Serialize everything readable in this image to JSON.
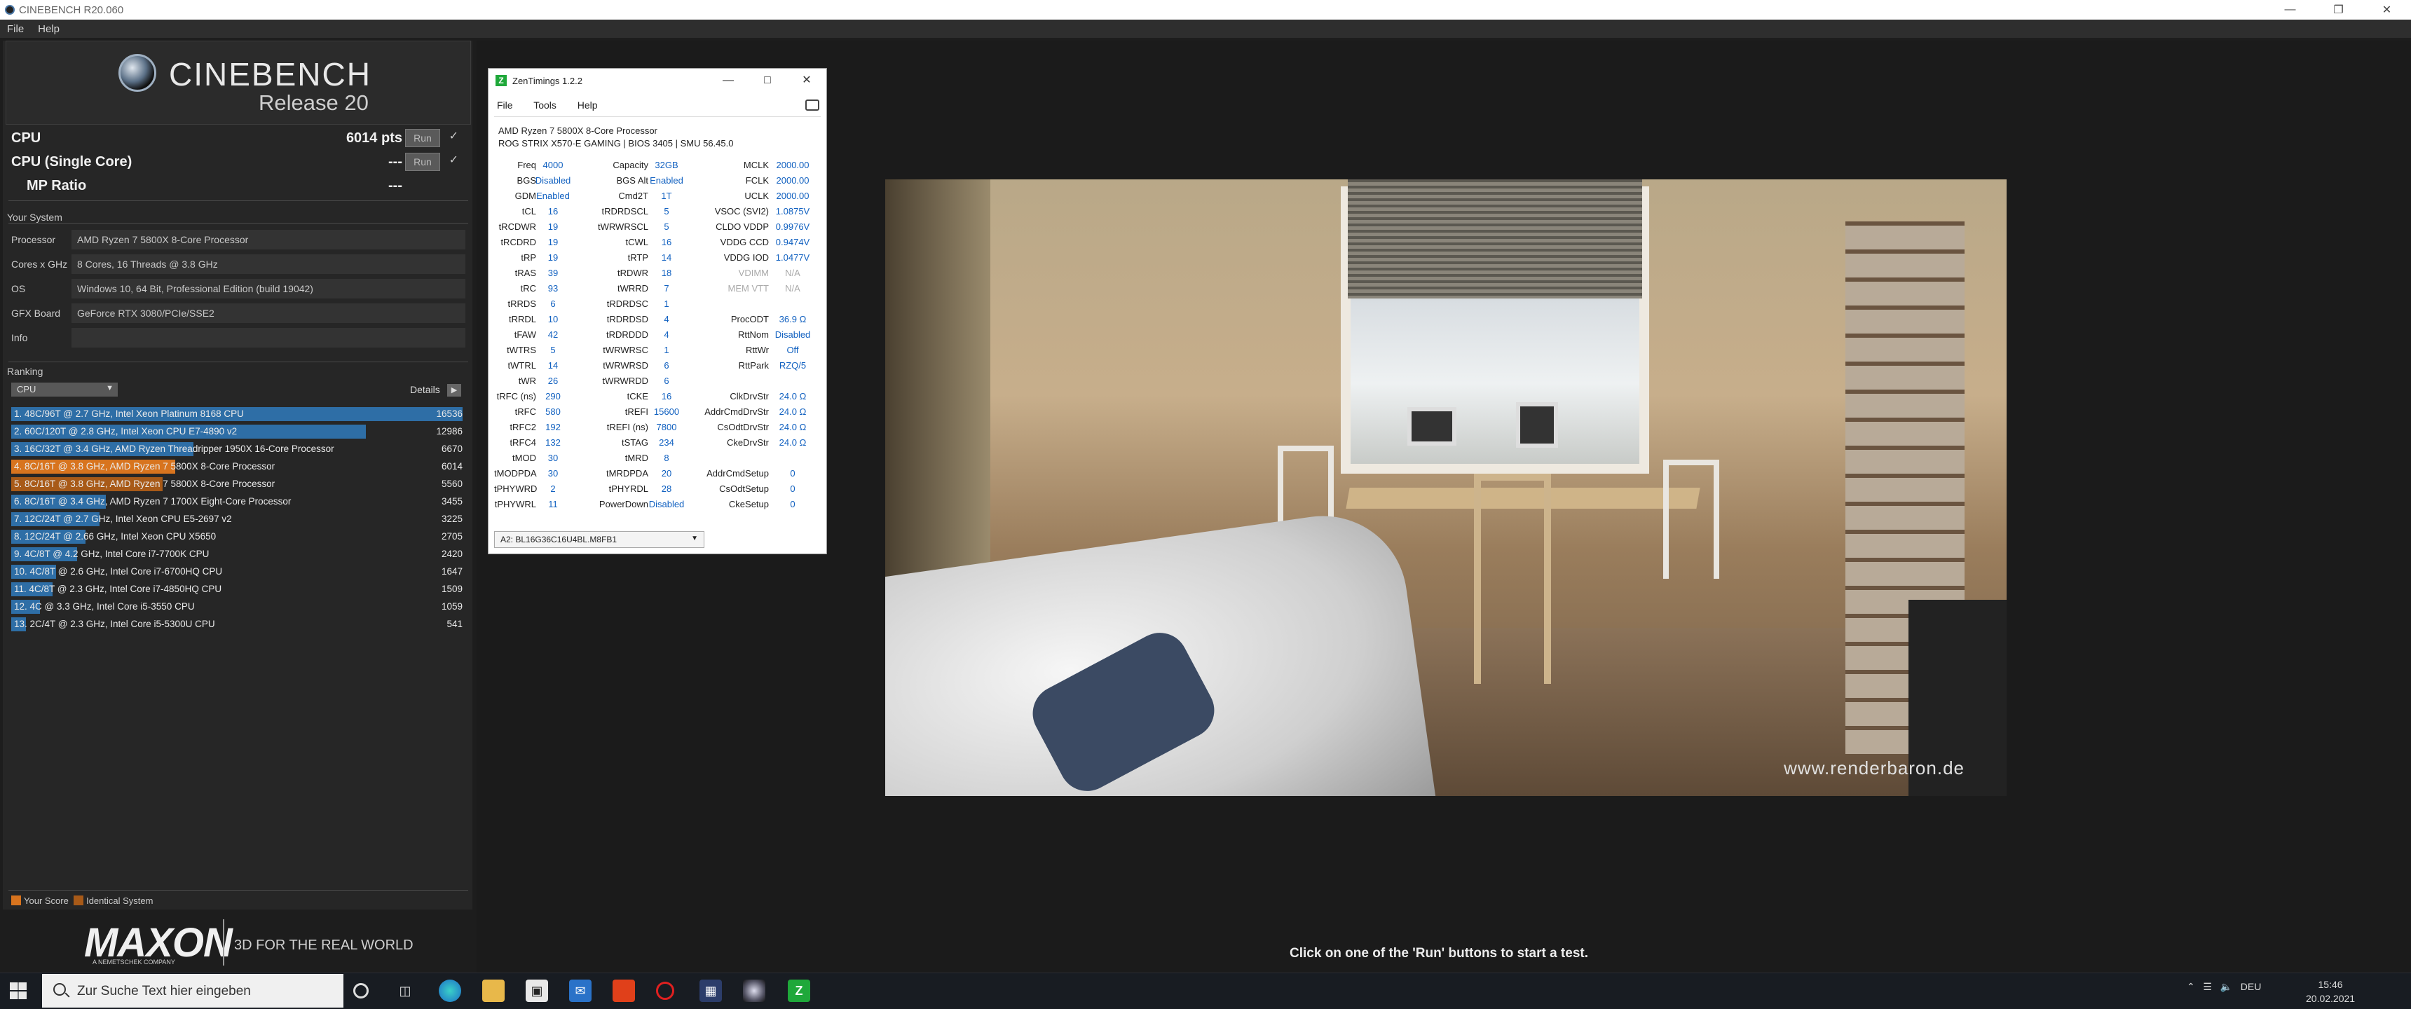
{
  "window": {
    "title": "CINEBENCH R20.060"
  },
  "menu": {
    "file": "File",
    "help": "Help"
  },
  "logo": {
    "brand": "CINEBENCH",
    "release": "Release 20"
  },
  "scores": {
    "cpu_label": "CPU",
    "cpu_value": "6014 pts",
    "single_label": "CPU (Single Core)",
    "single_value": "---",
    "mp_label": "MP Ratio",
    "mp_value": "---",
    "run_label": "Run",
    "check": "✓"
  },
  "system": {
    "title": "Your System",
    "rows": [
      {
        "key": "Processor",
        "value": "AMD Ryzen 7 5800X 8-Core Processor"
      },
      {
        "key": "Cores x GHz",
        "value": "8 Cores, 16 Threads @ 3.8 GHz"
      },
      {
        "key": "OS",
        "value": "Windows 10, 64 Bit, Professional Edition (build 19042)"
      },
      {
        "key": "GFX Board",
        "value": "GeForce RTX 3080/PCIe/SSE2"
      },
      {
        "key": "Info",
        "value": ""
      }
    ]
  },
  "ranking": {
    "title": "Ranking",
    "combo": "CPU",
    "details": "Details",
    "rows": [
      {
        "text": "1. 48C/96T @ 2.7 GHz, Intel Xeon Platinum 8168 CPU",
        "score": "16536",
        "fraction": 1.0,
        "kind": "ref"
      },
      {
        "text": "2. 60C/120T @ 2.8 GHz, Intel Xeon CPU E7-4890 v2",
        "score": "12986",
        "fraction": 0.785,
        "kind": "ref"
      },
      {
        "text": "3. 16C/32T @ 3.4 GHz, AMD Ryzen Threadripper 1950X 16-Core Processor",
        "score": "6670",
        "fraction": 0.403,
        "kind": "ref"
      },
      {
        "text": "4. 8C/16T @ 3.8 GHz, AMD Ryzen 7 5800X 8-Core Processor",
        "score": "6014",
        "fraction": 0.364,
        "kind": "your"
      },
      {
        "text": "5. 8C/16T @ 3.8 GHz, AMD Ryzen 7 5800X 8-Core Processor",
        "score": "5560",
        "fraction": 0.336,
        "kind": "identical"
      },
      {
        "text": "6. 8C/16T @ 3.4 GHz, AMD Ryzen 7 1700X Eight-Core Processor",
        "score": "3455",
        "fraction": 0.209,
        "kind": "ref"
      },
      {
        "text": "7. 12C/24T @ 2.7 GHz, Intel Xeon CPU E5-2697 v2",
        "score": "3225",
        "fraction": 0.195,
        "kind": "ref"
      },
      {
        "text": "8. 12C/24T @ 2.66 GHz, Intel Xeon CPU X5650",
        "score": "2705",
        "fraction": 0.164,
        "kind": "ref"
      },
      {
        "text": "9. 4C/8T @ 4.2 GHz, Intel Core i7-7700K CPU",
        "score": "2420",
        "fraction": 0.146,
        "kind": "ref"
      },
      {
        "text": "10. 4C/8T @ 2.6 GHz, Intel Core i7-6700HQ CPU",
        "score": "1647",
        "fraction": 0.1,
        "kind": "ref"
      },
      {
        "text": "11. 4C/8T @ 2.3 GHz, Intel Core i7-4850HQ CPU",
        "score": "1509",
        "fraction": 0.091,
        "kind": "ref"
      },
      {
        "text": "12. 4C @ 3.3 GHz, Intel Core i5-3550 CPU",
        "score": "1059",
        "fraction": 0.064,
        "kind": "ref"
      },
      {
        "text": "13. 2C/4T @ 2.3 GHz, Intel Core i5-5300U CPU",
        "score": "541",
        "fraction": 0.033,
        "kind": "ref"
      }
    ],
    "legend_your": "Your Score",
    "legend_identical": "Identical System"
  },
  "colors": {
    "ref_bar": "#2e6ea6",
    "your_bar": "#d8741e",
    "identical_bar": "#a85a18"
  },
  "maxon": {
    "logo": "MAXON",
    "sub": "A NEMETSCHEK COMPANY",
    "tagline": "3D FOR THE REAL WORLD"
  },
  "render": {
    "watermark": "www.renderbaron.de"
  },
  "hint": "Click on one of the 'Run' buttons to start a test.",
  "zentimings": {
    "title": "ZenTimings 1.2.2",
    "menu": [
      "File",
      "Tools",
      "Help"
    ],
    "cpu": "AMD Ryzen 7 5800X 8-Core Processor",
    "board": "ROG STRIX X570-E GAMING | BIOS 3405 | SMU 56.45.0",
    "top": [
      [
        "Freq",
        "4000",
        "Capacity",
        "32GB",
        "MCLK",
        "2000.00"
      ],
      [
        "BGS",
        "Disabled",
        "BGS Alt",
        "Enabled",
        "FCLK",
        "2000.00"
      ],
      [
        "GDM",
        "Enabled",
        "Cmd2T",
        "1T",
        "UCLK",
        "2000.00"
      ]
    ],
    "rows": [
      [
        "tCL",
        "16",
        "tRDRDSCL",
        "5",
        "VSOC (SVI2)",
        "1.0875V"
      ],
      [
        "tRCDWR",
        "19",
        "tWRWRSCL",
        "5",
        "CLDO VDDP",
        "0.9976V"
      ],
      [
        "tRCDRD",
        "19",
        "tCWL",
        "16",
        "VDDG CCD",
        "0.9474V"
      ],
      [
        "tRP",
        "19",
        "tRTP",
        "14",
        "VDDG IOD",
        "1.0477V"
      ],
      [
        "tRAS",
        "39",
        "tRDWR",
        "18",
        "VDIMM",
        "N/A"
      ],
      [
        "tRC",
        "93",
        "tWRRD",
        "7",
        "MEM VTT",
        "N/A"
      ],
      [
        "tRRDS",
        "6",
        "tRDRDSC",
        "1",
        "",
        ""
      ],
      [
        "tRRDL",
        "10",
        "tRDRDSD",
        "4",
        "ProcODT",
        "36.9 Ω"
      ],
      [
        "tFAW",
        "42",
        "tRDRDDD",
        "4",
        "RttNom",
        "Disabled"
      ],
      [
        "tWTRS",
        "5",
        "tWRWRSC",
        "1",
        "RttWr",
        "Off"
      ],
      [
        "tWTRL",
        "14",
        "tWRWRSD",
        "6",
        "RttPark",
        "RZQ/5"
      ],
      [
        "tWR",
        "26",
        "tWRWRDD",
        "6",
        "",
        ""
      ],
      [
        "tRFC (ns)",
        "290",
        "tCKE",
        "16",
        "ClkDrvStr",
        "24.0 Ω"
      ],
      [
        "tRFC",
        "580",
        "tREFI",
        "15600",
        "AddrCmdDrvStr",
        "24.0 Ω"
      ],
      [
        "tRFC2",
        "192",
        "tREFI (ns)",
        "7800",
        "CsOdtDrvStr",
        "24.0 Ω"
      ],
      [
        "tRFC4",
        "132",
        "tSTAG",
        "234",
        "CkeDrvStr",
        "24.0 Ω"
      ],
      [
        "tMOD",
        "30",
        "tMRD",
        "8",
        "",
        ""
      ],
      [
        "tMODPDA",
        "30",
        "tMRDPDA",
        "20",
        "AddrCmdSetup",
        "0"
      ],
      [
        "tPHYWRD",
        "2",
        "tPHYRDL",
        "28",
        "CsOdtSetup",
        "0"
      ],
      [
        "tPHYWRL",
        "11",
        "PowerDown",
        "Disabled",
        "CkeSetup",
        "0"
      ]
    ],
    "module": "A2: BL16G36C16U4BL.M8FB1"
  },
  "taskbar": {
    "search_placeholder": "Zur Suche Text hier eingeben",
    "lang": "DEU",
    "time": "15:46",
    "date": "20.02.2021"
  }
}
